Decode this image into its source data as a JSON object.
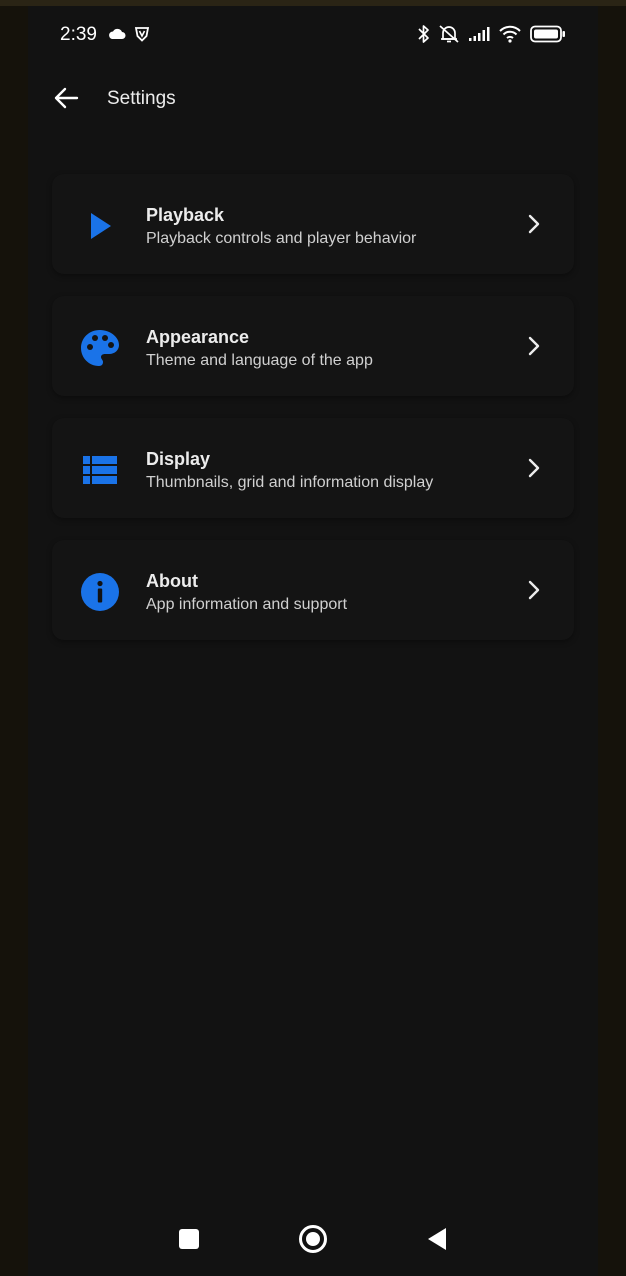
{
  "status_bar": {
    "time": "2:39",
    "left_icons": [
      "cloud-icon",
      "vpn-shield-icon"
    ],
    "right_icons": [
      "bluetooth-icon",
      "alarm-off-icon",
      "signal-icon",
      "wifi-icon",
      "battery-icon"
    ]
  },
  "app_bar": {
    "title": "Settings",
    "back_icon": "arrow-back-icon"
  },
  "settings": [
    {
      "title": "Playback",
      "subtitle": "Playback controls and player behavior",
      "icon": "play-icon"
    },
    {
      "title": "Appearance",
      "subtitle": "Theme and language of the app",
      "icon": "palette-icon"
    },
    {
      "title": "Display",
      "subtitle": "Thumbnails, grid and information display",
      "icon": "list-icon"
    },
    {
      "title": "About",
      "subtitle": "App information and support",
      "icon": "info-icon"
    }
  ],
  "nav_bar": {
    "buttons": [
      "recents-square-icon",
      "home-circle-icon",
      "back-triangle-icon"
    ]
  },
  "colors": {
    "accent": "#1a73e8",
    "background": "#121212",
    "card": "#141414",
    "text_primary": "#ececec",
    "text_secondary": "#d0d0d0"
  }
}
